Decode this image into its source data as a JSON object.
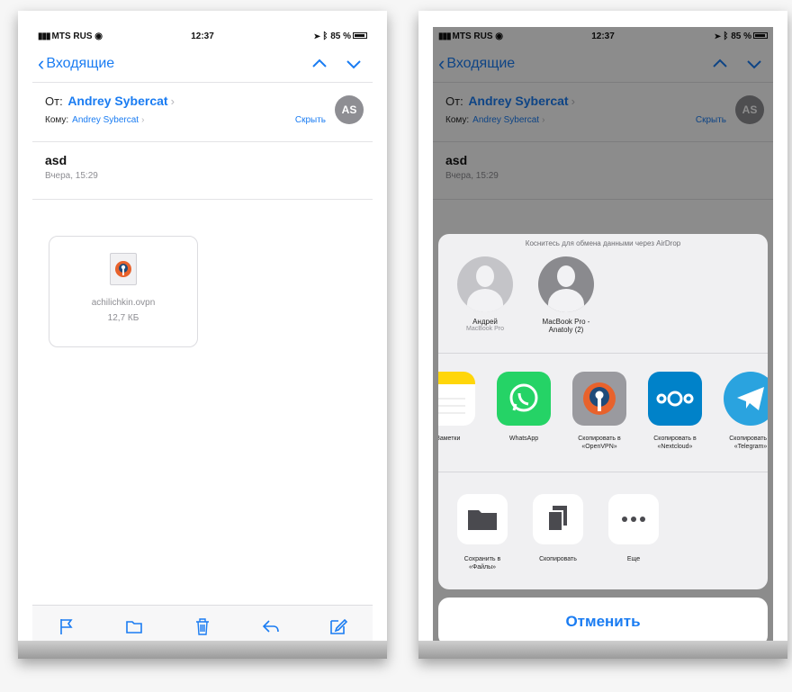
{
  "status_bar": {
    "carrier": "MTS RUS",
    "time": "12:37",
    "battery": "85 %"
  },
  "nav": {
    "back_label": "Входящие"
  },
  "email": {
    "from_label": "От:",
    "from_name": "Andrey Sybercat",
    "to_label": "Кому:",
    "to_name": "Andrey Sybercat",
    "hide_label": "Скрыть",
    "avatar_initials": "AS",
    "subject": "asd",
    "date": "Вчера, 15:29",
    "attachment": {
      "name": "achilichkin.ovpn",
      "size": "12,7 КБ",
      "icon": "openvpn-file-icon"
    }
  },
  "toolbar": {
    "icons": [
      "flag-icon",
      "folder-icon",
      "trash-icon",
      "reply-icon",
      "compose-icon"
    ]
  },
  "share_sheet": {
    "airdrop_hint": "Коснитесь для обмена данными через AirDrop",
    "people": [
      {
        "name": "Андрей",
        "device": "MacBook Pro"
      },
      {
        "name": "MacBook Pro - Anatoly (2)",
        "device": ""
      }
    ],
    "apps": [
      {
        "label": "Заметки",
        "color": "#ffd60a"
      },
      {
        "label": "WhatsApp",
        "color": "#25d366"
      },
      {
        "label": "Скопировать в «OpenVPN»",
        "color": "#9a9a9f"
      },
      {
        "label": "Скопировать в «Nextcloud»",
        "color": "#0082c9"
      },
      {
        "label": "Скопировать в «Telegram»",
        "color": "#2aa3df"
      }
    ],
    "actions": [
      {
        "label": "Сохранить в «Файлы»",
        "icon": "folder-icon"
      },
      {
        "label": "Скопировать",
        "icon": "copy-icon"
      },
      {
        "label": "Еще",
        "icon": "more-icon"
      }
    ],
    "cancel_label": "Отменить"
  },
  "colors": {
    "ios_blue": "#1a7cf2",
    "separator": "#e3e3e6"
  }
}
